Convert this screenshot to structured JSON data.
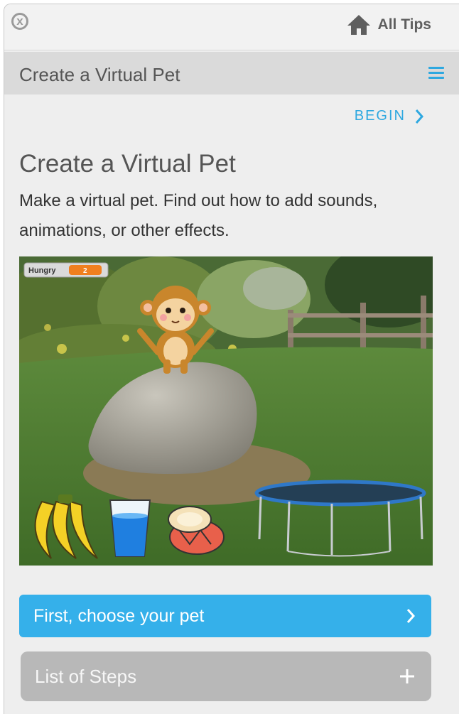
{
  "header": {
    "close_label": "x",
    "all_tips_label": "All Tips"
  },
  "titlebar": {
    "title": "Create a Virtual Pet"
  },
  "content": {
    "begin_label": "BEGIN",
    "title": "Create a Virtual Pet",
    "description": "Make a virtual pet. Find out how to add sounds, animations, or other effects.",
    "image": {
      "monitor_label": "Hungry",
      "monitor_value": "2"
    }
  },
  "buttons": {
    "first_step_label": "First, choose your pet",
    "list_of_steps_label": "List of Steps"
  },
  "colors": {
    "accent": "#35b0ea",
    "link": "#2ea8e0",
    "steps_button": "#b8b8b8"
  }
}
